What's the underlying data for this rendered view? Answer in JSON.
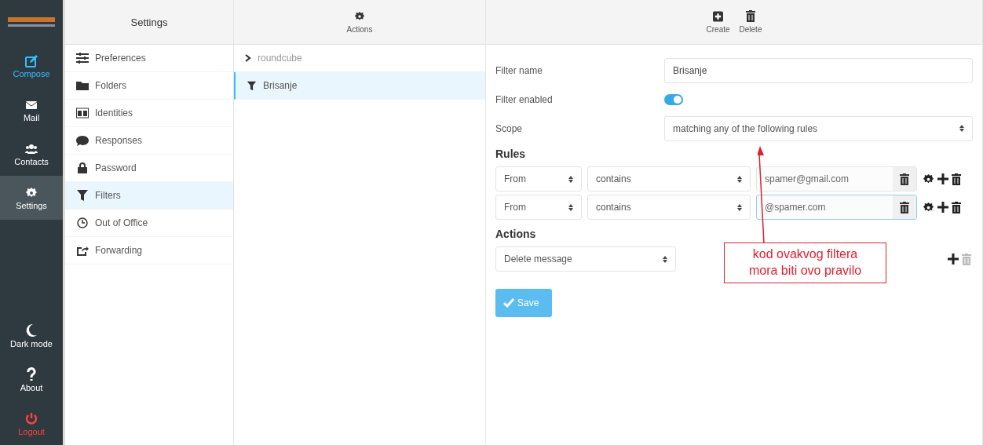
{
  "nav": [
    {
      "label": "Compose",
      "kind": "primary",
      "selected": false
    },
    {
      "label": "Mail",
      "kind": "plain",
      "selected": false
    },
    {
      "label": "Contacts",
      "kind": "plain",
      "selected": false
    },
    {
      "label": "Settings",
      "kind": "plain",
      "selected": true
    }
  ],
  "nav_bottom": [
    {
      "label": "Dark mode",
      "kind": "plain"
    },
    {
      "label": "About",
      "kind": "plain"
    },
    {
      "label": "Logout",
      "kind": "danger"
    }
  ],
  "settings": {
    "title": "Settings",
    "items": [
      {
        "label": "Preferences",
        "selected": false
      },
      {
        "label": "Folders",
        "selected": false
      },
      {
        "label": "Identities",
        "selected": false
      },
      {
        "label": "Responses",
        "selected": false
      },
      {
        "label": "Password",
        "selected": false
      },
      {
        "label": "Filters",
        "selected": true
      },
      {
        "label": "Out of Office",
        "selected": false
      },
      {
        "label": "Forwarding",
        "selected": false
      }
    ]
  },
  "filters": {
    "toolbar": "Actions",
    "items": [
      {
        "label": "roundcube",
        "kind": "set",
        "selected": false
      },
      {
        "label": "Brisanje",
        "kind": "filter",
        "selected": true
      }
    ]
  },
  "toolbar": [
    "Create",
    "Delete"
  ],
  "form": {
    "name_label": "Filter name",
    "name": "Brisanje",
    "enabled_label": "Filter enabled",
    "enabled": true,
    "scope_label": "Scope",
    "scope": "matching any of the following rules",
    "rules_title": "Rules",
    "rules": [
      {
        "header": "From",
        "op": "contains",
        "value": "spamer@gmail.com",
        "focused": false
      },
      {
        "header": "From",
        "op": "contains",
        "value": "@spamer.com",
        "focused": true
      }
    ],
    "actions_title": "Actions",
    "actions": [
      {
        "value": "Delete message"
      }
    ],
    "save": "Save"
  },
  "annotation": "kod ovakvog filtera\nmora biti ovo pravilo"
}
